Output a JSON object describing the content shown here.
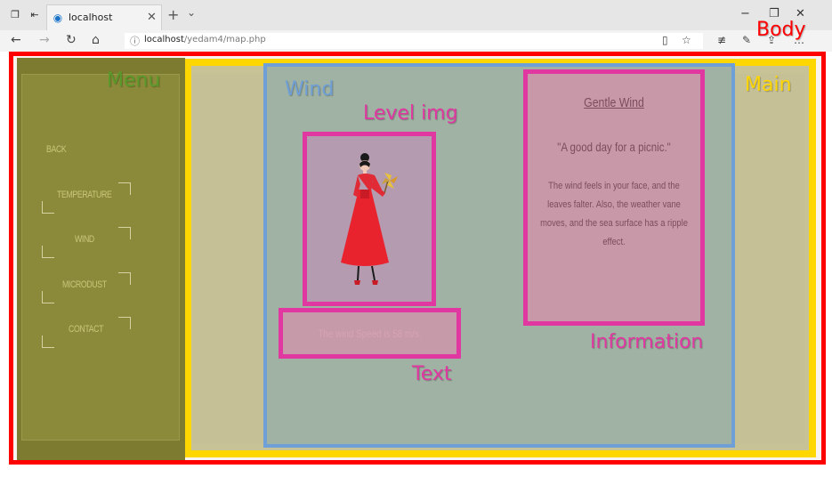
{
  "browser": {
    "tab_title": "localhost",
    "url_host": "localhost",
    "url_path": "/yedam4/map.php"
  },
  "menu": {
    "items": [
      "BACK",
      "TEMPERATURE",
      "WIND",
      "MICRODUST",
      "CONTACT"
    ]
  },
  "wind": {
    "info_title": "Gentle Wind",
    "info_quote": "\"A good day for a picnic.\"",
    "info_desc": "The wind feels in your face, and the leaves falter. Also, the weather vane moves, and the sea surface has a ripple effect.",
    "speed_text": "The wind Speed is 58 m/s."
  },
  "annotations": {
    "body": "Body",
    "menu": "Menu",
    "main": "Main",
    "wind": "Wind",
    "level_img": "Level img",
    "information": "Information",
    "text": "Text"
  },
  "colors": {
    "body_border": "#ff0000",
    "menu_fill": "#7c7b2f",
    "main_border": "#ffd700",
    "wind_border": "#6e9fd6",
    "box_border": "#e037a0"
  }
}
